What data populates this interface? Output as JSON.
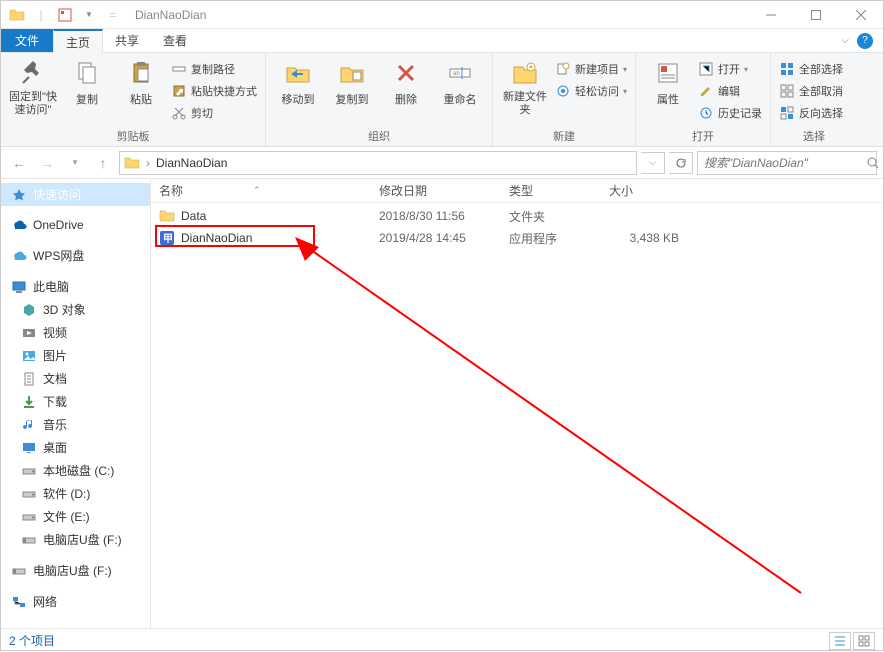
{
  "window": {
    "title": "DianNaoDian"
  },
  "tabs": {
    "file": "文件",
    "home": "主页",
    "share": "共享",
    "view": "查看"
  },
  "ribbon": {
    "pin": "固定到\"快速访问\"",
    "copy": "复制",
    "paste": "粘贴",
    "copy_path": "复制路径",
    "paste_shortcut": "粘贴快捷方式",
    "cut": "剪切",
    "clipboard_group": "剪贴板",
    "move_to": "移动到",
    "copy_to": "复制到",
    "delete": "删除",
    "rename": "重命名",
    "organize_group": "组织",
    "new_folder": "新建文件夹",
    "new_item": "新建项目",
    "easy_access": "轻松访问",
    "new_group": "新建",
    "properties": "属性",
    "open": "打开",
    "edit": "编辑",
    "history": "历史记录",
    "open_group": "打开",
    "select_all": "全部选择",
    "select_none": "全部取消",
    "invert_selection": "反向选择",
    "select_group": "选择"
  },
  "address": {
    "current": "DianNaoDian",
    "search_placeholder": "搜索\"DianNaoDian\""
  },
  "sidebar": {
    "quick_access": "快速访问",
    "onedrive": "OneDrive",
    "wps": "WPS网盘",
    "this_pc": "此电脑",
    "3d": "3D 对象",
    "videos": "视频",
    "pictures": "图片",
    "documents": "文档",
    "downloads": "下载",
    "music": "音乐",
    "desktop": "桌面",
    "local_c": "本地磁盘 (C:)",
    "soft_d": "软件 (D:)",
    "docs_e": "文件 (E:)",
    "usb_f": "电脑店U盘 (F:)",
    "usb_f2": "电脑店U盘 (F:)",
    "network": "网络"
  },
  "columns": {
    "name": "名称",
    "date": "修改日期",
    "type": "类型",
    "size": "大小"
  },
  "files": [
    {
      "name": "Data",
      "date": "2018/8/30 11:56",
      "type": "文件夹",
      "size": ""
    },
    {
      "name": "DianNaoDian",
      "date": "2019/4/28 14:45",
      "type": "应用程序",
      "size": "3,438 KB"
    }
  ],
  "status": {
    "items": "2 个项目"
  }
}
